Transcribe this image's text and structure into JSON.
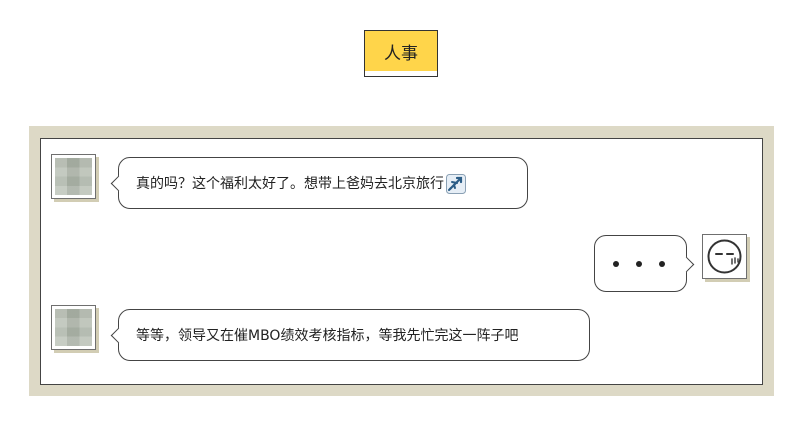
{
  "title": "人事",
  "messages": [
    {
      "side": "left",
      "text": "真的吗？这个福利太好了。想带上爸妈去北京旅行",
      "icon": "airplane-icon"
    },
    {
      "side": "right",
      "text": "",
      "content": "ellipsis-dots"
    },
    {
      "side": "left",
      "text": "等等，领导又在催MBO绩效考核指标，等我先忙完这一阵子吧"
    }
  ],
  "colors": {
    "title_fill": "#ffd54a",
    "frame": "#ddd9c6",
    "border": "#444444"
  }
}
